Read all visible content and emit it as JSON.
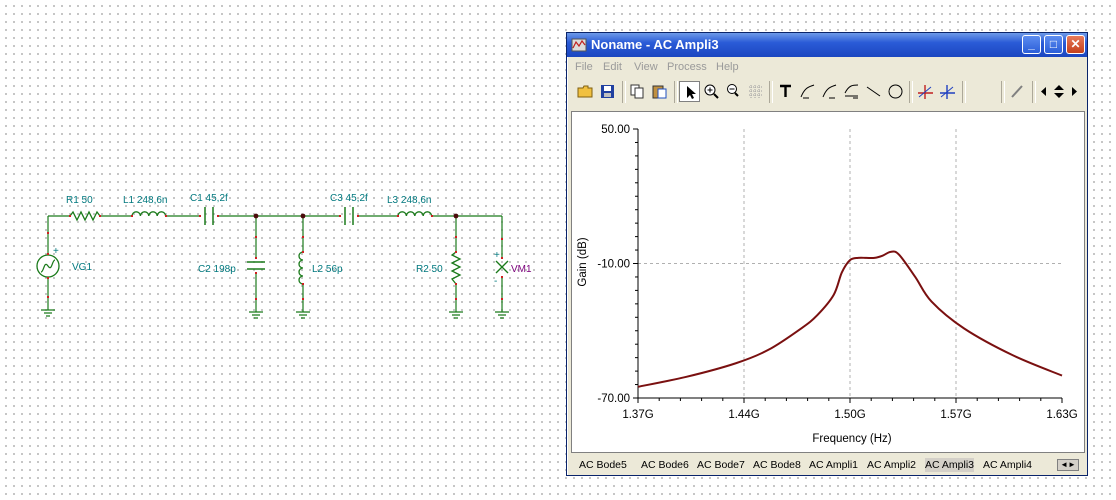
{
  "window": {
    "title": "Noname - AC Ampli3",
    "buttons": {
      "minimize": "_",
      "maximize": "□",
      "close": "✕"
    }
  },
  "menu": [
    "File",
    "Edit",
    "View",
    "Process",
    "Help"
  ],
  "toolbar_icons": [
    "open-folder-icon",
    "save-icon",
    "copy-icon",
    "paste-icon",
    "pointer-icon",
    "zoom-in-icon",
    "zoom-100-icon",
    "grid-icon",
    "text-tool-icon",
    "curve-tool-1-icon",
    "curve-tool-2-icon",
    "curve-tool-3-icon",
    "line-tool-icon",
    "circle-tool-icon",
    "cursor-a-icon",
    "cursor-b-icon",
    "pencil-icon",
    "arrows-icon"
  ],
  "schematic": {
    "labels": {
      "r1": "R1 50",
      "l1": "L1 248,6n",
      "c1": "C1 45,2f",
      "c3": "C3 45,2f",
      "l3": "L3 248,6n",
      "vg1": "VG1",
      "c2": "C2 198p",
      "l2": "L2 56p",
      "r2": "R2 50",
      "vm1": "VM1",
      "plus1": "+",
      "plus2": "+",
      "minus": "-"
    }
  },
  "chart_data": {
    "type": "line",
    "title": "",
    "xlabel": "Frequency (Hz)",
    "ylabel": "Gain (dB)",
    "xlim": [
      1.37,
      1.63
    ],
    "ylim": [
      -70,
      50
    ],
    "x_tick_labels": [
      "1.37G",
      "1.44G",
      "1.50G",
      "1.57G",
      "1.63G"
    ],
    "y_tick_labels": [
      "50.00",
      "-10.00",
      "-70.00"
    ],
    "grid": true,
    "series": [
      {
        "color": "#7a1010",
        "x_unit": "GHz",
        "x": [
          1.37,
          1.4,
          1.43,
          1.45,
          1.47,
          1.48,
          1.49,
          1.495,
          1.5,
          1.505,
          1.51,
          1.515,
          1.52,
          1.525,
          1.53,
          1.54,
          1.55,
          1.57,
          1.6,
          1.63
        ],
        "y": [
          -65,
          -60.5,
          -54.5,
          -48.5,
          -39,
          -33,
          -24,
          -14,
          -8.5,
          -7.5,
          -7.5,
          -7.5,
          -6.5,
          -4.8,
          -6,
          -16,
          -27,
          -39,
          -51,
          -60
        ]
      }
    ]
  },
  "tabs": [
    "AC Bode5",
    "AC Bode6",
    "AC Bode7",
    "AC Bode8",
    "AC Ampli1",
    "AC Ampli2",
    "AC Ampli3",
    "AC Ampli4"
  ],
  "active_tab": "AC Ampli3",
  "tab_scroll": "◄►"
}
